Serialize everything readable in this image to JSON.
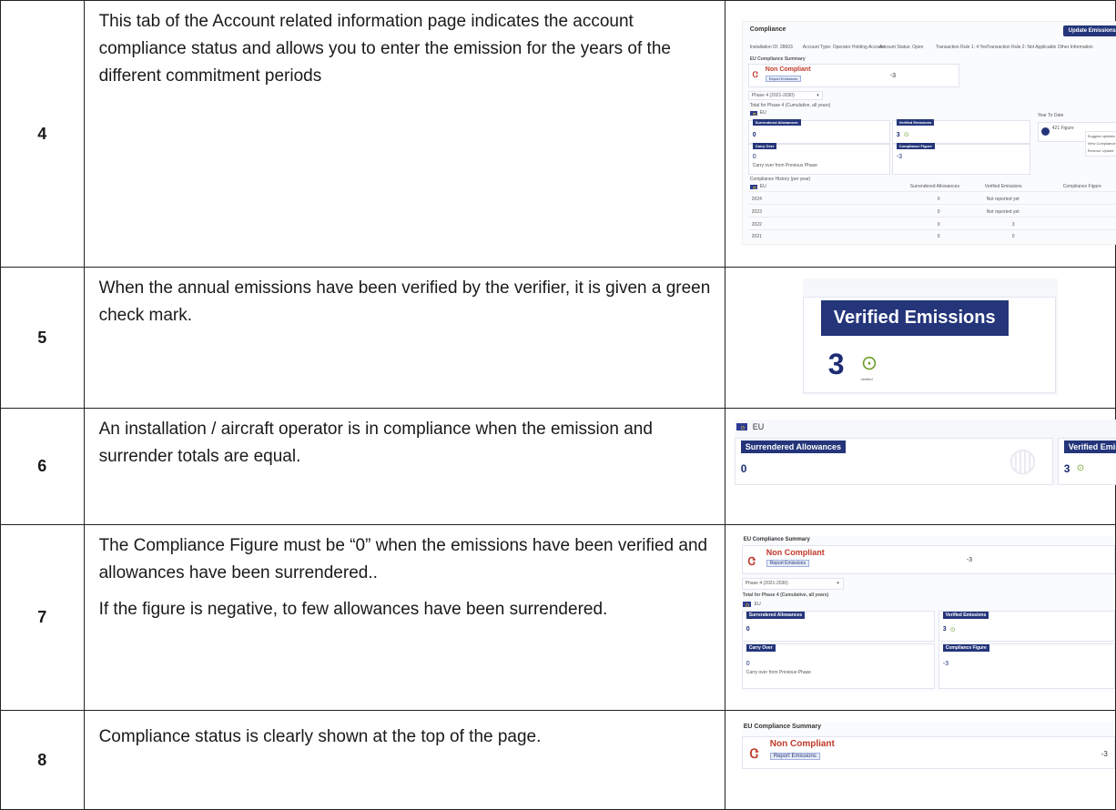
{
  "rows": [
    {
      "number": "4",
      "text": "This tab of the Account related information page indicates the account compliance status and allows you to enter the emission for the years of the different commitment periods",
      "screenshot": {
        "header_title": "Compliance",
        "action_button": "Update Emissions",
        "info_bar": [
          "Installation ID: 28603",
          "Account Type: Operator Holding Account",
          "Account Status: Open",
          "Transaction Rule 1: 4 Yes",
          "Transaction Rule 2: Not Applicable",
          "Other Information"
        ],
        "summary_title": "EU Compliance Summary",
        "status": "Non Compliant",
        "report_link": "Report Emissions",
        "figure": "-3",
        "phase_select": "Phase 4 (2021-2030)",
        "total_title": "Total for Phase 4 (Cumulative, all years)",
        "region": "EU",
        "cards": [
          {
            "label": "Surrendered Allowances",
            "value": "0"
          },
          {
            "label": "Verified Emissions",
            "value": "3"
          },
          {
            "label": "Carry Over",
            "value": "0",
            "sub": "Carry over from Previous Phase"
          },
          {
            "label": "Compliance Figure",
            "value": "-3"
          }
        ],
        "year_to_date": "Year To Date",
        "ytd_item": "421 Figure",
        "menu": [
          "Suggest updates",
          "View Compliance",
          "Remove Update"
        ],
        "history_title": "Compliance History (per year)",
        "history_columns": [
          "EU",
          "Surrendered Allowances",
          "Verified Emissions",
          "Compliance Figure"
        ],
        "history_rows": [
          {
            "year": "2024",
            "surrendered": "0",
            "emissions": "Not reported yet",
            "figure": ""
          },
          {
            "year": "2023",
            "surrendered": "0",
            "emissions": "Not reported yet",
            "figure": ""
          },
          {
            "year": "2022",
            "surrendered": "0",
            "emissions": "3",
            "figure": ""
          },
          {
            "year": "2021",
            "surrendered": "0",
            "emissions": "0",
            "figure": ""
          }
        ]
      }
    },
    {
      "number": "5",
      "text": "When the annual emissions have been verified by the verifier, it is given a green check mark.",
      "screenshot": {
        "label": "Verified Emissions",
        "value": "3",
        "sub": "verified"
      }
    },
    {
      "number": "6",
      "text": "An installation / aircraft operator is in compliance when the emission and surrender totals are equal.",
      "screenshot": {
        "region": "EU",
        "surrendered_label": "Surrendered Allowances",
        "surrendered_value": "0",
        "verified_label": "Verified Emissions",
        "verified_value": "3"
      }
    },
    {
      "number": "7",
      "paragraphs": [
        "The Compliance Figure must be “0” when the emissions have been verified and allowances have been surrendered..",
        "If the figure is negative, to few allowances have been surrendered."
      ],
      "screenshot": {
        "summary_title": "EU Compliance Summary",
        "status": "Non Compliant",
        "report_link": "Report Emissions",
        "figure": "-3",
        "phase_select": "Phase 4 (2021-2030)",
        "total_title": "Total for Phase 4 (Cumulative, all years)",
        "region": "EU",
        "cards": [
          {
            "label": "Surrendered Allowances",
            "value": "0"
          },
          {
            "label": "Verified Emissions",
            "value": "3"
          },
          {
            "label": "Carry Over",
            "value": "0",
            "sub": "Carry over from Previous Phase"
          },
          {
            "label": "Compliance Figure",
            "value": "-3"
          }
        ]
      }
    },
    {
      "number": "8",
      "text": "Compliance status is clearly shown at the top of the page.",
      "screenshot": {
        "summary_title": "EU Compliance Summary",
        "status": "Non Compliant",
        "report_link": "Report Emissions",
        "figure": "-3"
      }
    }
  ]
}
